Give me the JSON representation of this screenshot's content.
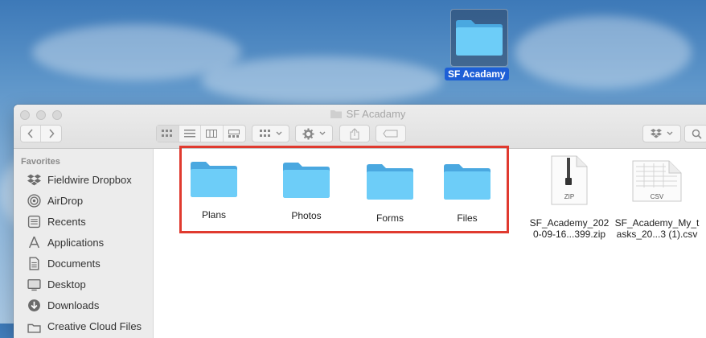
{
  "desktop": {
    "folder_label": "SF Acadamy"
  },
  "window": {
    "title": "SF Acadamy"
  },
  "sidebar": {
    "heading": "Favorites",
    "items": [
      {
        "label": "Fieldwire Dropbox",
        "icon": "dropbox-icon"
      },
      {
        "label": "AirDrop",
        "icon": "airdrop-icon"
      },
      {
        "label": "Recents",
        "icon": "recents-icon"
      },
      {
        "label": "Applications",
        "icon": "applications-icon"
      },
      {
        "label": "Documents",
        "icon": "documents-icon"
      },
      {
        "label": "Desktop",
        "icon": "desktop-icon"
      },
      {
        "label": "Downloads",
        "icon": "downloads-icon"
      },
      {
        "label": "Creative Cloud Files",
        "icon": "creative-cloud-icon"
      }
    ]
  },
  "files": {
    "folders": [
      "Plans",
      "Photos",
      "Forms",
      "Files"
    ],
    "zip": {
      "line1": "SF_Academy_202",
      "line2": "0-09-16...399.zip",
      "badge": "ZIP"
    },
    "csv": {
      "line1": "SF_Academy_My_t",
      "line2": "asks_20...3 (1).csv",
      "badge": "CSV"
    }
  },
  "colors": {
    "selection": "#1e5fd6",
    "highlight": "#e03a2f",
    "folder": "#5ec3f5"
  }
}
